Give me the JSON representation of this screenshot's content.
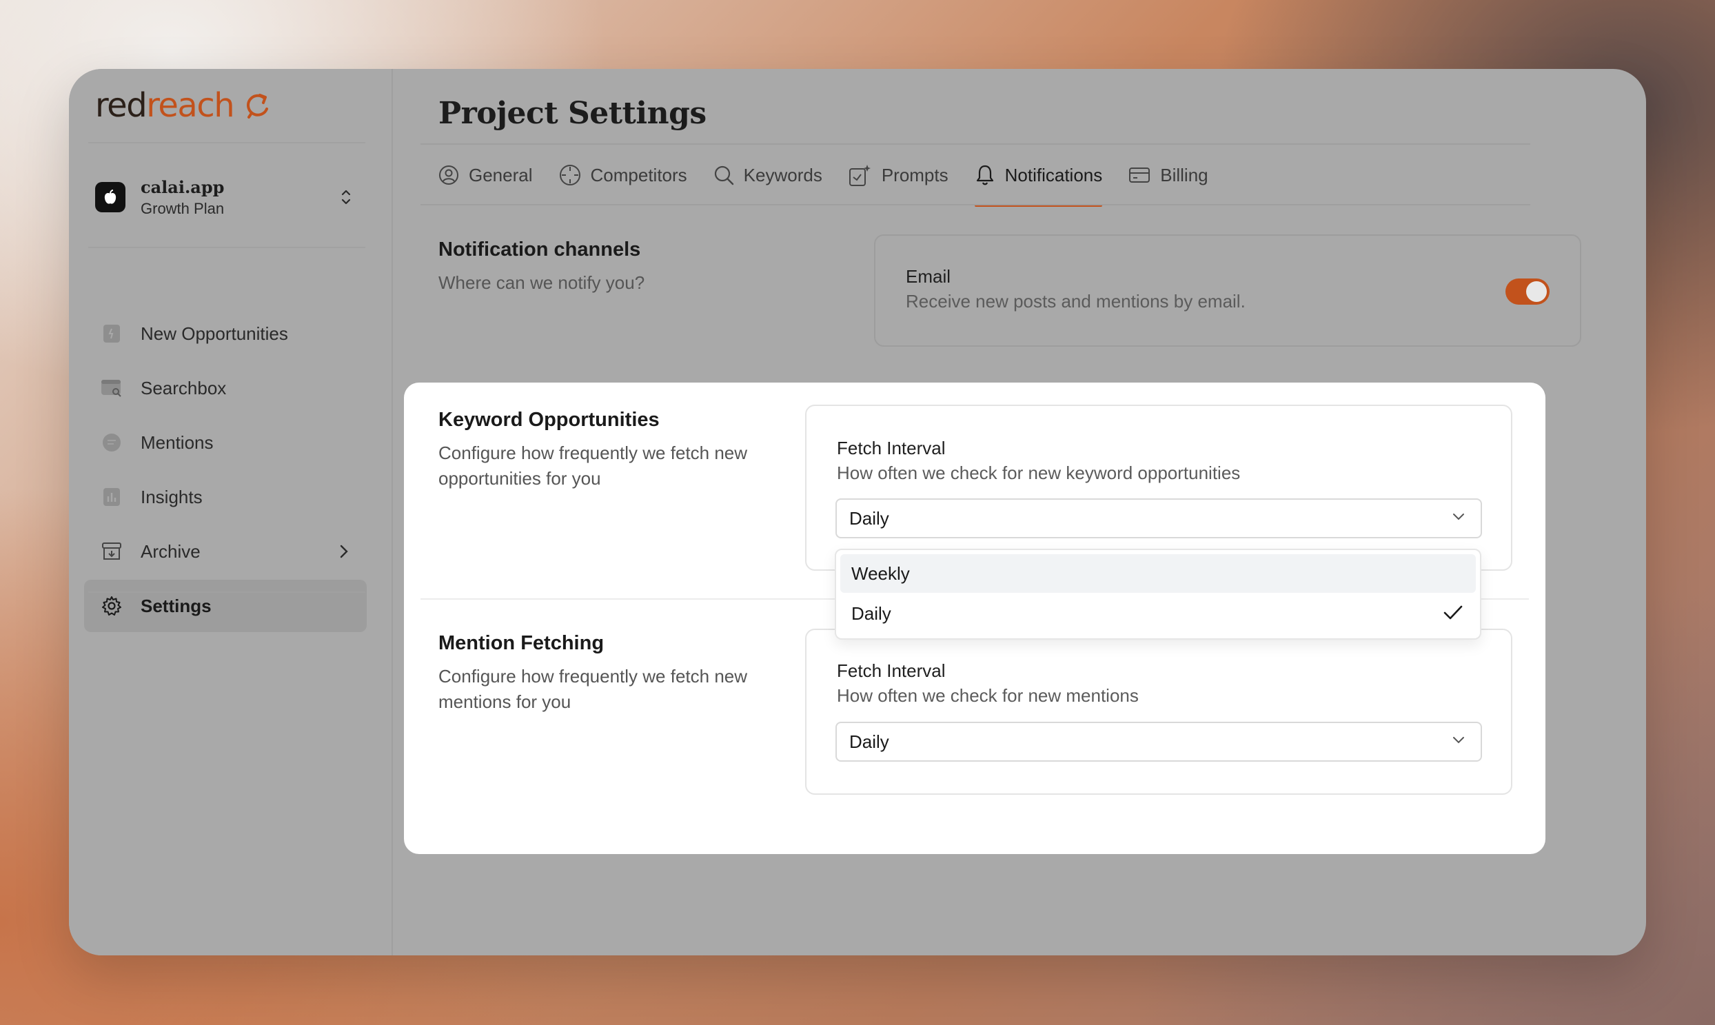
{
  "brand": {
    "part1": "red",
    "part2": "reach",
    "accent": "#c2521c"
  },
  "project": {
    "name": "calai.app",
    "plan": "Growth Plan"
  },
  "nav": [
    {
      "label": "New Opportunities",
      "icon": "new-opportunities-icon"
    },
    {
      "label": "Searchbox",
      "icon": "searchbox-icon"
    },
    {
      "label": "Mentions",
      "icon": "mentions-icon"
    },
    {
      "label": "Insights",
      "icon": "insights-icon"
    },
    {
      "label": "Archive",
      "icon": "archive-icon"
    },
    {
      "label": "Settings",
      "icon": "gear-icon",
      "active": true
    }
  ],
  "page": {
    "title": "Project Settings"
  },
  "tabs": [
    {
      "label": "General",
      "icon": "user-circle-icon"
    },
    {
      "label": "Competitors",
      "icon": "crosshair-icon"
    },
    {
      "label": "Keywords",
      "icon": "search-icon"
    },
    {
      "label": "Prompts",
      "icon": "sparkle-icon"
    },
    {
      "label": "Notifications",
      "icon": "bell-icon",
      "active": true
    },
    {
      "label": "Billing",
      "icon": "credit-card-icon"
    }
  ],
  "channels": {
    "title": "Notification channels",
    "desc": "Where can we notify you?",
    "email_label": "Email",
    "email_desc": "Receive new posts and mentions by email.",
    "email_enabled": true
  },
  "keyword_opps": {
    "title": "Keyword Opportunities",
    "desc": "Configure how frequently we fetch new opportunities for you",
    "field_label": "Fetch Interval",
    "field_desc": "How often we check for new keyword opportunities",
    "value": "Daily"
  },
  "dropdown": {
    "options": [
      "Weekly",
      "Daily"
    ],
    "hovered": "Weekly",
    "selected": "Daily"
  },
  "mention_fetch": {
    "title": "Mention Fetching",
    "desc": "Configure how frequently we fetch new mentions for you",
    "field_label": "Fetch Interval",
    "field_desc": "How often we check for new mentions",
    "value": "Daily"
  }
}
